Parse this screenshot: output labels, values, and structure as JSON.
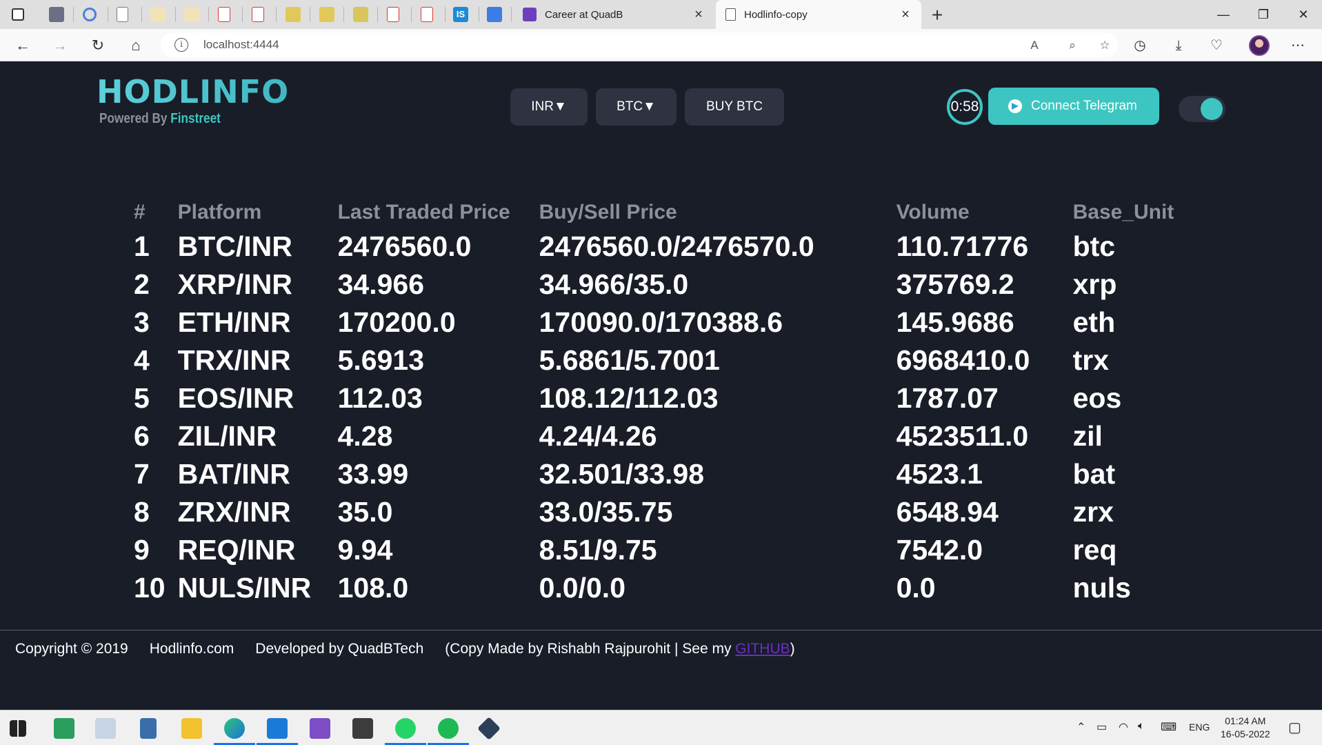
{
  "browser": {
    "tabs": [
      {
        "title": "Career at QuadB",
        "active": false
      },
      {
        "title": "Hodlinfo-copy",
        "active": true
      }
    ],
    "url": "localhost:4444"
  },
  "header": {
    "logo": "HODLINFO",
    "powered_by": "Powered By",
    "powered_brand": "Finstreet",
    "currency_select": "INR▼",
    "crypto_select": "BTC▼",
    "buy_button": "BUY BTC",
    "timer": "0:58",
    "telegram_button": "Connect Telegram",
    "theme_toggle_on": true
  },
  "table": {
    "headers": [
      "#",
      "Platform",
      "Last Traded Price",
      "Buy/Sell Price",
      "Volume",
      "Base_Unit"
    ],
    "rows": [
      [
        "1",
        "BTC/INR",
        "2476560.0",
        "2476560.0/2476570.0",
        "110.71776",
        "btc"
      ],
      [
        "2",
        "XRP/INR",
        "34.966",
        "34.966/35.0",
        "375769.2",
        "xrp"
      ],
      [
        "3",
        "ETH/INR",
        "170200.0",
        "170090.0/170388.6",
        "145.9686",
        "eth"
      ],
      [
        "4",
        "TRX/INR",
        "5.6913",
        "5.6861/5.7001",
        "6968410.0",
        "trx"
      ],
      [
        "5",
        "EOS/INR",
        "112.03",
        "108.12/112.03",
        "1787.07",
        "eos"
      ],
      [
        "6",
        "ZIL/INR",
        "4.28",
        "4.24/4.26",
        "4523511.0",
        "zil"
      ],
      [
        "7",
        "BAT/INR",
        "33.99",
        "32.501/33.98",
        "4523.1",
        "bat"
      ],
      [
        "8",
        "ZRX/INR",
        "35.0",
        "33.0/35.75",
        "6548.94",
        "zrx"
      ],
      [
        "9",
        "REQ/INR",
        "9.94",
        "8.51/9.75",
        "7542.0",
        "req"
      ],
      [
        "10",
        "NULS/INR",
        "108.0",
        "0.0/0.0",
        "0.0",
        "nuls"
      ]
    ]
  },
  "footer": {
    "copyright": "Copyright © 2019",
    "site": "Hodlinfo.com",
    "developer": "Developed by QuadBTech",
    "copy_prefix": "(Copy Made by Rishabh Rajpurohit | See my ",
    "github_link": "GITHUB",
    "copy_suffix": ")"
  },
  "taskbar": {
    "time": "01:24 AM",
    "date": "16-05-2022",
    "language": "ENG"
  },
  "colors": {
    "accent": "#3dc6c1",
    "page_background": "#191d28",
    "button_background": "#2e3241",
    "header_text": "#8d909a"
  }
}
